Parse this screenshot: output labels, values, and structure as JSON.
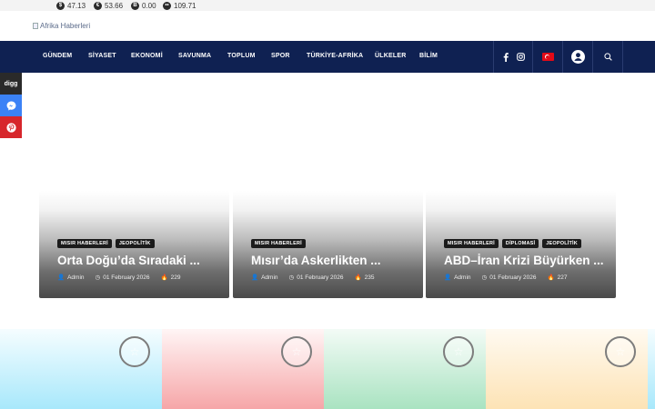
{
  "ticker": [
    {
      "symbol": "$",
      "value": "47.13"
    },
    {
      "symbol": "€",
      "value": "53.66"
    },
    {
      "symbol": "B",
      "value": "0.00"
    },
    {
      "symbol": "••",
      "value": "109.71"
    }
  ],
  "logo": {
    "alt": "Afrika Haberleri"
  },
  "nav": {
    "items": [
      "GÜNDEM",
      "SİYASET",
      "EKONOMİ",
      "SAVUNMA",
      "TOPLUM",
      "SPOR",
      "TÜRKİYE-AFRİKA",
      "ÜLKELER",
      "BİLİM"
    ]
  },
  "share": {
    "digg": "digg"
  },
  "cards": [
    {
      "tags": [
        "MISIR HABERLERİ",
        "JEOPOLİTİK"
      ],
      "title": "Orta Doğu’da Sıradaki ...",
      "author": "Admin",
      "date": "01 February 2026",
      "views": "229"
    },
    {
      "tags": [
        "MISIR HABERLERİ"
      ],
      "title": "Mısır’da Askerlikten ...",
      "author": "Admin",
      "date": "01 February 2026",
      "views": "235"
    },
    {
      "tags": [
        "MISIR HABERLERİ",
        "DİPLOMASİ",
        "JEOPOLİTİK"
      ],
      "title": "ABD–İran Krizi Büyürken ...",
      "author": "Admin",
      "date": "01 February 2026",
      "views": "227"
    }
  ],
  "colors": {
    "navbar": "#0f2152",
    "share_digg": "#2a2a2a",
    "share_messenger": "#3b82f6",
    "share_pinterest": "#d7262b",
    "tile_blue": "#a8e8fb",
    "tile_pink": "#f6a6a8",
    "tile_green": "#a9e3c1",
    "tile_yellow": "#fde3b5"
  }
}
